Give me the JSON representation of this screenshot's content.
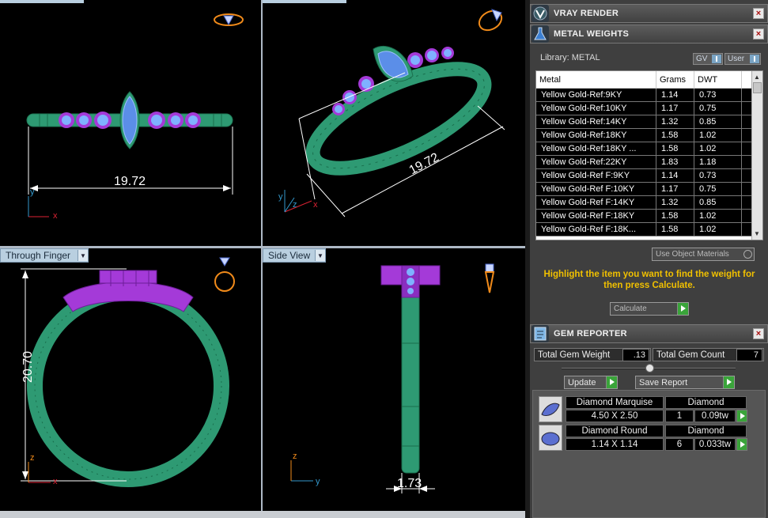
{
  "viewports": {
    "top_left": {
      "dimension": "19.72"
    },
    "top_right": {
      "dimension": "19.72"
    },
    "bottom_left": {
      "tab_label": "Through Finger",
      "dimension": "20.70"
    },
    "bottom_right": {
      "tab_label": "Side View",
      "dimension": "1.73"
    },
    "axes": {
      "x": "x",
      "y": "y",
      "z": "z"
    }
  },
  "panel": {
    "vray": {
      "title": "VRAY RENDER"
    },
    "metal": {
      "title": "METAL WEIGHTS",
      "library_label": "Library: METAL",
      "gv_label": "GV",
      "user_label": "User",
      "columns": [
        "Metal",
        "Grams",
        "DWT"
      ],
      "rows": [
        [
          "Yellow Gold-Ref:9KY",
          "1.14",
          "0.73"
        ],
        [
          "Yellow Gold-Ref:10KY",
          "1.17",
          "0.75"
        ],
        [
          "Yellow Gold-Ref:14KY",
          "1.32",
          "0.85"
        ],
        [
          "Yellow Gold-Ref:18KY",
          "1.58",
          "1.02"
        ],
        [
          "Yellow Gold-Ref:18KY ...",
          "1.58",
          "1.02"
        ],
        [
          "Yellow Gold-Ref:22KY",
          "1.83",
          "1.18"
        ],
        [
          "Yellow Gold-Ref F:9KY",
          "1.14",
          "0.73"
        ],
        [
          "Yellow Gold-Ref F:10KY",
          "1.17",
          "0.75"
        ],
        [
          "Yellow Gold-Ref F:14KY",
          "1.32",
          "0.85"
        ],
        [
          "Yellow Gold-Ref F:18KY",
          "1.58",
          "1.02"
        ],
        [
          "Yellow Gold-Ref F:18K...",
          "1.58",
          "1.02"
        ]
      ],
      "use_object_materials": "Use Object Materials",
      "hint": "Highlight the item you want to find the weight for then press Calculate.",
      "calculate_label": "Calculate"
    },
    "gem": {
      "title": "GEM REPORTER",
      "total_weight_label": "Total Gem Weight",
      "total_weight_value": ".13",
      "total_count_label": "Total Gem Count",
      "total_count_value": "7",
      "update_label": "Update",
      "save_label": "Save Report",
      "items": [
        {
          "name": "Diamond Marquise",
          "material": "Diamond",
          "size": "4.50 X 2.50",
          "count": "1",
          "weight": "0.09tw"
        },
        {
          "name": "Diamond Round",
          "material": "Diamond",
          "size": "1.14 X 1.14",
          "count": "6",
          "weight": "0.033tw"
        }
      ]
    }
  },
  "colors": {
    "metal_green": "#2e9a73",
    "setting_purple": "#a43ad8",
    "gem_blue": "#5b8ee8",
    "hint_yellow": "#f0c000",
    "go_green": "#3aa43a"
  }
}
